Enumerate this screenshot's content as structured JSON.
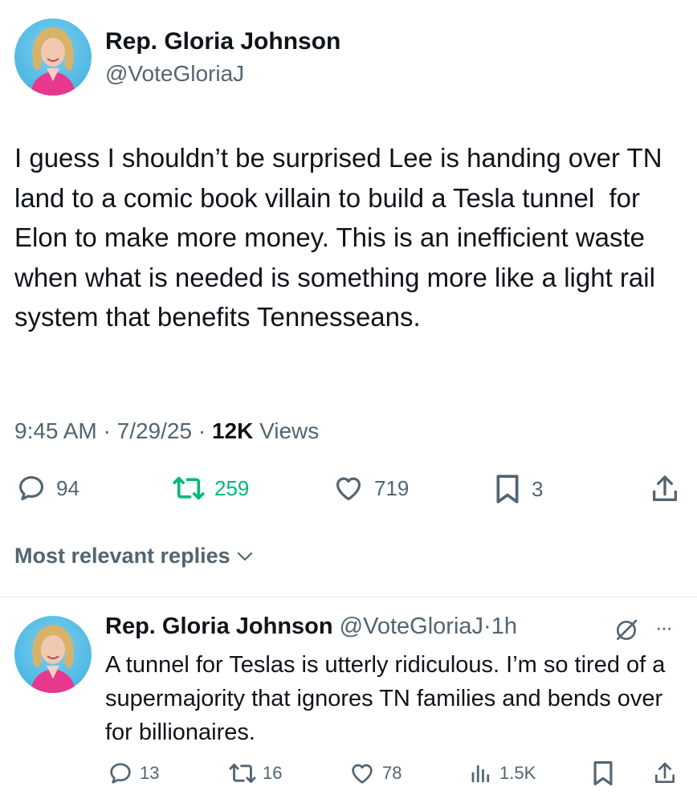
{
  "tweet": {
    "author_name": "Rep. Gloria Johnson",
    "author_handle": "@VoteGloriaJ",
    "text": "I guess I shouldn’t be surprised Lee is handing over TN land to a comic book villain to build a Tesla tunnel  for Elon to make more money. This is an inefficient waste when what is needed is something more like a light rail system that benefits Tennesseans.",
    "time": "9:45 AM",
    "date": "7/29/25",
    "views_count": "12K",
    "views_label": "Views",
    "separator": "·",
    "actions": {
      "replies": "94",
      "reposts": "259",
      "likes": "719",
      "bookmarks": "3"
    }
  },
  "replies_section": {
    "label": "Most relevant replies"
  },
  "reply": {
    "author_name": "Rep. Gloria Johnson",
    "author_handle": "@VoteGloriaJ",
    "time": "1h",
    "separator": "·",
    "more": "···",
    "text": "A tunnel for Teslas is utterly ridiculous. I’m so tired of a supermajority that ignores TN families and bends over for billionaires.",
    "actions": {
      "replies": "13",
      "reposts": "16",
      "likes": "78",
      "views": "1.5K"
    }
  },
  "colors": {
    "repost_active": "#00ba7c",
    "secondary_text": "#536471",
    "primary_text": "#0f1419"
  },
  "icons": [
    "avatar",
    "reply-icon",
    "repost-icon",
    "like-icon",
    "bookmark-icon",
    "share-icon",
    "chevron-down-icon",
    "grok-icon",
    "more-icon",
    "views-icon"
  ]
}
